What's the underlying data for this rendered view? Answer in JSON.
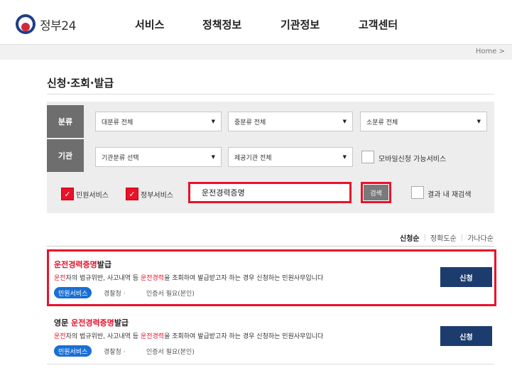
{
  "header": {
    "logo_text": "정부24",
    "nav": [
      "서비스",
      "정책정보",
      "기관정보",
      "고객센터"
    ]
  },
  "breadcrumb": "Home >",
  "page_title": "신청·조회·발급",
  "filters": {
    "category_label": "분류",
    "category_selects": [
      "대분류 전체",
      "중분류 전체",
      "소분류 전체"
    ],
    "agency_label": "기관",
    "agency_selects": [
      "기관분류 선택",
      "제공기관 전체"
    ],
    "mobile_option": "모바일신청 가능서비스",
    "civil_service": "민원서비스",
    "gov_service": "정부서비스",
    "search_value": "운전경력증명",
    "search_button": "검색",
    "research_option": "결과 내 재검색"
  },
  "sort_options": [
    "신청순",
    "정확도순",
    "가나다순"
  ],
  "results": [
    {
      "title_prefix": "",
      "title_highlight": "운전경력증명",
      "title_suffix": "발급",
      "desc_1": "운전",
      "desc_2": "자의 법규위반, 사고내역 등 ",
      "desc_3": "운전경력",
      "desc_4": "을 조회하여 발급받고자 하는 경우 신청하는 민원사무입니다",
      "badge": "민원서비스",
      "agency": "경찰청 ·",
      "cert": "인증서 필요(본인)",
      "button": "신청"
    },
    {
      "title_prefix": "영문 ",
      "title_highlight": "운전경력증명",
      "title_suffix": "발급",
      "desc_1": "운전",
      "desc_2": "자의 법규위반, 사고내역 등 ",
      "desc_3": "운전경력",
      "desc_4": "을 조회하여 발급받고자 하는 경우 신청하는 민원사무입니다",
      "badge": "민원서비스",
      "agency": "경찰청 ·",
      "cert": "인증서 필요(본인)",
      "button": "신청"
    }
  ]
}
